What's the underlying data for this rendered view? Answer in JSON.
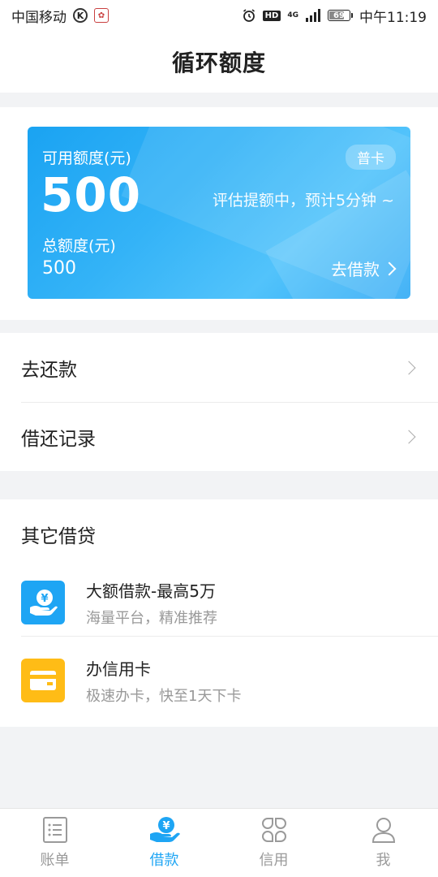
{
  "status_bar": {
    "carrier": "中国移动",
    "k_icon_text": "K",
    "network": "4G",
    "battery_level": "69",
    "battery_fraction": 0.69,
    "time": "中午11:19"
  },
  "header": {
    "title": "循环额度"
  },
  "card": {
    "available_label": "可用额度(元)",
    "available_amount": "500",
    "badge": "普卡",
    "assess_note": "评估提额中，预计5分钟 ~",
    "total_label": "总额度(元)",
    "total_amount": "500",
    "borrow_link": "去借款"
  },
  "menu": {
    "items": [
      {
        "label": "去还款"
      },
      {
        "label": "借还记录"
      }
    ]
  },
  "other_loans": {
    "title": "其它借贷",
    "items": [
      {
        "title": "大额借款-最高5万",
        "subtitle": "海量平台，精准推荐",
        "icon": "yuan-hand-icon",
        "color": "#1ea5f4"
      },
      {
        "title": "办信用卡",
        "subtitle": "极速办卡，快至1天下卡",
        "icon": "card-icon",
        "color": "#ffbc16"
      }
    ]
  },
  "tabbar": {
    "tabs": [
      {
        "label": "账单",
        "icon": "bill-icon",
        "active": false
      },
      {
        "label": "借款",
        "icon": "loan-icon",
        "active": true
      },
      {
        "label": "信用",
        "icon": "credit-icon",
        "active": false
      },
      {
        "label": "我",
        "icon": "profile-icon",
        "active": false
      }
    ]
  },
  "colors": {
    "accent": "#1ea5f4",
    "card_yellow": "#ffbc16",
    "background": "#f2f3f5"
  }
}
